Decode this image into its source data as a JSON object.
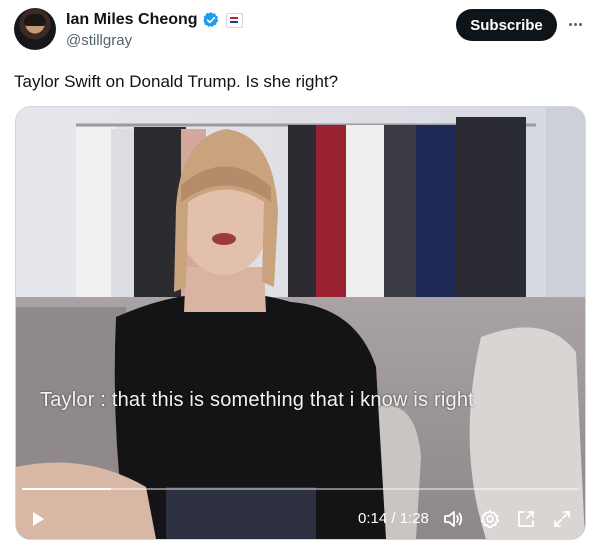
{
  "author": {
    "name": "Ian Miles Cheong",
    "handle": "@stillgray",
    "verified_icon": "verified-badge-icon",
    "affiliation_icon": "affiliate-flag-icon"
  },
  "actions": {
    "subscribe_label": "Subscribe",
    "more_icon": "more-dots-icon"
  },
  "tweet": {
    "text": "Taylor Swift on Donald Trump. Is she right?"
  },
  "video": {
    "caption": "Taylor : that this is something that i know is right",
    "current_time": "0:14",
    "duration": "1:28",
    "time_display": "0:14 / 1:28",
    "progress": 0.16,
    "icons": [
      "play-icon",
      "volume-icon",
      "settings-gear-icon",
      "picture-in-picture-icon",
      "fullscreen-icon"
    ]
  },
  "colors": {
    "subscribe_bg": "#0f1419",
    "verified_blue": "#1d9bf0",
    "handle_gray": "#536471"
  }
}
